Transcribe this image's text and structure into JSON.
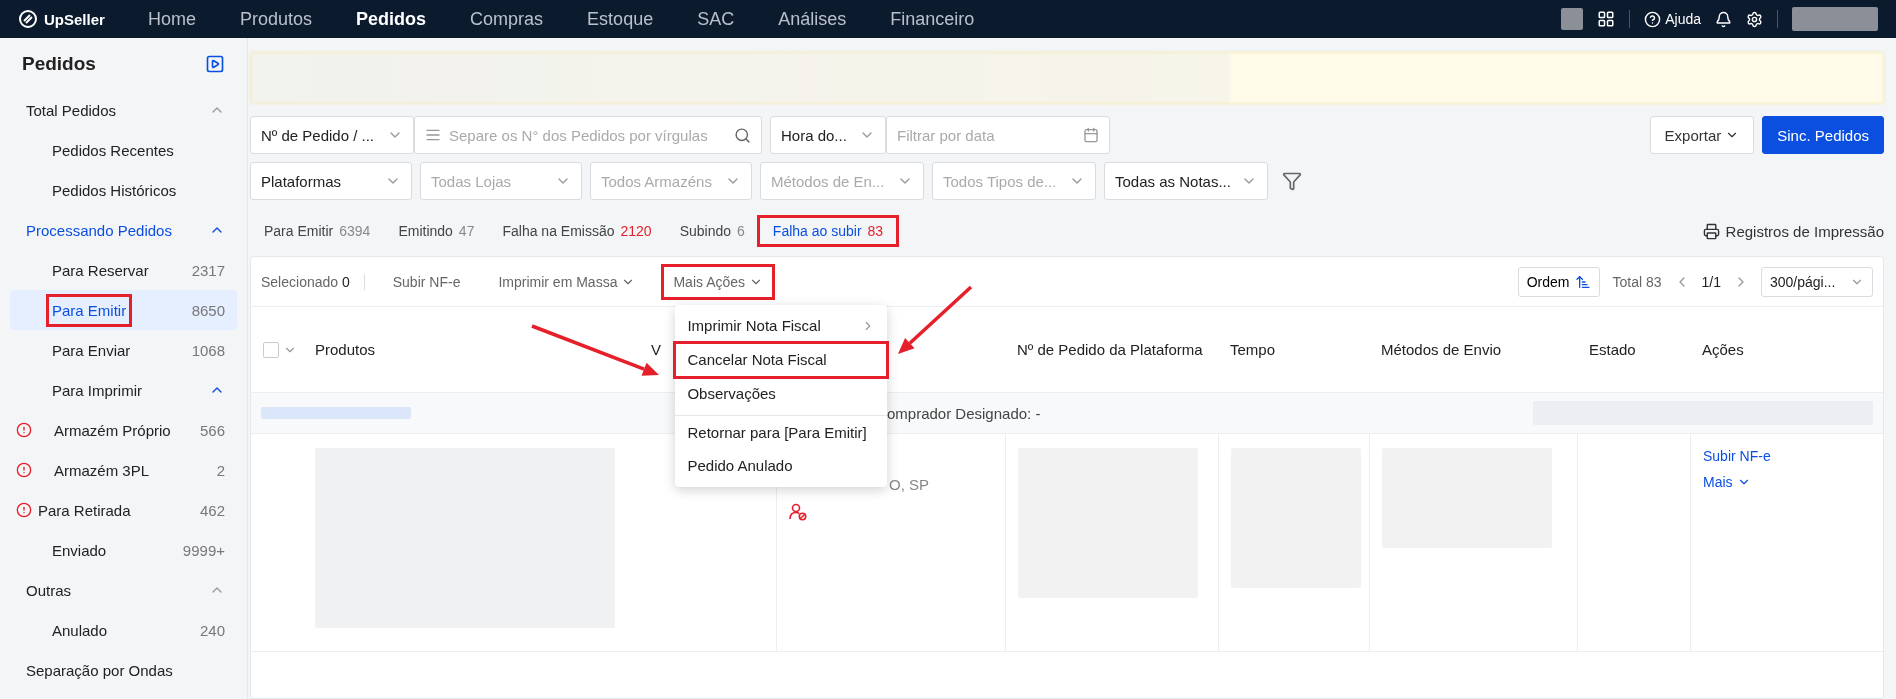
{
  "app": {
    "logo": "UpSeller"
  },
  "nav": [
    {
      "label": "Home",
      "selected": false
    },
    {
      "label": "Produtos",
      "selected": false
    },
    {
      "label": "Pedidos",
      "selected": true
    },
    {
      "label": "Compras",
      "selected": false
    },
    {
      "label": "Estoque",
      "selected": false
    },
    {
      "label": "SAC",
      "selected": false
    },
    {
      "label": "Análises",
      "selected": false
    },
    {
      "label": "Financeiro",
      "selected": false
    }
  ],
  "topbar_right": {
    "help": "Ajuda"
  },
  "sidebar": {
    "title": "Pedidos",
    "items": [
      {
        "label": "Total Pedidos",
        "expanded": true,
        "children": [
          {
            "label": "Pedidos Recentes",
            "selected": false
          },
          {
            "label": "Pedidos Históricos",
            "selected": false
          }
        ]
      },
      {
        "label": "Processando Pedidos",
        "expanded": true,
        "children": [
          {
            "label": "Para Reservar",
            "count": "2317",
            "selected": false
          },
          {
            "label": "Para Emitir",
            "count": "8650",
            "selected": true,
            "highlighted": true
          },
          {
            "label": "Para Enviar",
            "count": "1068",
            "selected": false
          },
          {
            "label": "Para Imprimir",
            "expanded": true,
            "children": [
              {
                "label": "Armazém Próprio",
                "count": "566",
                "selected": false,
                "warning": true
              },
              {
                "label": "Armazém 3PL",
                "count": "2",
                "selected": false,
                "warning": true
              }
            ]
          },
          {
            "label": "Para Retirada",
            "count": "462",
            "selected": false,
            "warning": true
          },
          {
            "label": "Enviado",
            "count": "9999+",
            "selected": false
          }
        ]
      },
      {
        "label": "Outras",
        "expanded": true,
        "children": [
          {
            "label": "Anulado",
            "count": "240",
            "selected": false
          }
        ]
      },
      {
        "label": "Separação por Ondas",
        "selected": false
      }
    ]
  },
  "filters": {
    "row1": [
      {
        "kind": "select",
        "value": "Nº de Pedido / ..."
      },
      {
        "kind": "search",
        "placeholder": "Separe os N° dos Pedidos por vírgulas"
      },
      {
        "kind": "select",
        "value": "Hora do..."
      },
      {
        "kind": "date",
        "placeholder": "Filtrar por data"
      }
    ],
    "buttons": [
      {
        "label": "Exportar",
        "primary": false,
        "caret": true
      },
      {
        "label": "Sinc. Pedidos",
        "primary": true,
        "caret": false
      }
    ],
    "row2": [
      {
        "kind": "select",
        "value": "Plataformas"
      },
      {
        "kind": "select",
        "placeholder": "Todas Lojas"
      },
      {
        "kind": "select",
        "placeholder": "Todos Armazéns"
      },
      {
        "kind": "select",
        "placeholder": "Métodos de En..."
      },
      {
        "kind": "select",
        "placeholder": "Todos Tipos de..."
      },
      {
        "kind": "select",
        "value": "Todas as Notas..."
      }
    ]
  },
  "status_tabs": [
    {
      "label": "Para Emitir",
      "count": "6394",
      "alert": false,
      "selected": false
    },
    {
      "label": "Emitindo",
      "count": "47",
      "alert": false,
      "selected": false
    },
    {
      "label": "Falha na Emissão",
      "count": "2120",
      "alert": true,
      "selected": false
    },
    {
      "label": "Subindo",
      "count": "6",
      "alert": false,
      "selected": false
    },
    {
      "label": "Falha ao subir",
      "count": "83",
      "alert": true,
      "selected": true,
      "highlighted": true
    }
  ],
  "print_log": "Registros de Impressão",
  "toolbar": {
    "selected_label": "Selecionado",
    "selected_count": "0",
    "actions": [
      {
        "label": "Subir NF-e",
        "caret": false
      },
      {
        "label": "Imprimir em Massa",
        "caret": true
      },
      {
        "label": "Mais Ações",
        "caret": true,
        "open": true,
        "highlighted": true
      }
    ],
    "order": "Ordem",
    "total": "Total 83",
    "page": "1/1",
    "page_size": "300/pági..."
  },
  "menu": [
    {
      "label": "Imprimir Nota Fiscal",
      "submenu": true
    },
    {
      "label": "Cancelar Nota Fiscal",
      "highlighted": true
    },
    {
      "label": "Observações"
    },
    {
      "label": "Retornar para [Para Emitir]",
      "divider_before": true
    },
    {
      "label": "Pedido Anulado"
    }
  ],
  "table": {
    "select_all_checked": false,
    "columns": [
      "Produtos",
      "V",
      "Nº de Pedido da Plataforma",
      "Tempo",
      "Métodos de Envio",
      "Estado",
      "Ações"
    ],
    "group_row": "omprador Designado: -",
    "row": {
      "address": "O, SP",
      "actions": [
        "Subir NF-e",
        "Mais"
      ]
    }
  }
}
